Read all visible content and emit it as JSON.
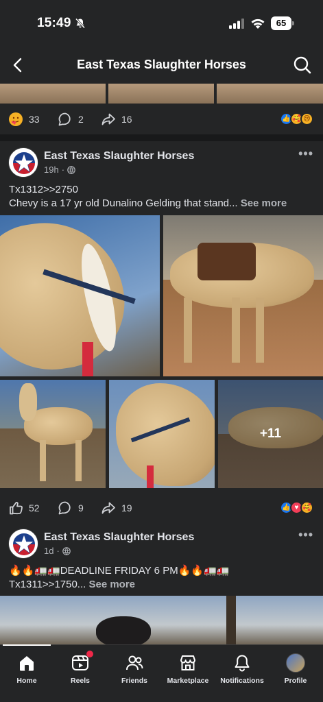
{
  "status_bar": {
    "time": "15:49",
    "battery": "65"
  },
  "header": {
    "title": "East Texas Slaughter Horses"
  },
  "post_prev": {
    "reaction_count": "33",
    "comment_count": "2",
    "share_count": "16"
  },
  "post_main": {
    "author": "East Texas Slaughter Horses",
    "time": "19h",
    "line1": "Tx1312>>2750",
    "line2": "Chevy is a 17 yr old Dunalino Gelding that stand...",
    "see_more": "See more",
    "extra_photos": "+11",
    "reaction_count": "52",
    "comment_count": "9",
    "share_count": "19"
  },
  "post_next": {
    "author": "East Texas Slaughter Horses",
    "time": "1d",
    "line1": "🔥🔥🚛🚛DEADLINE FRIDAY 6 PM🔥🔥🚛🚛",
    "line2": "Tx1311>>1750...",
    "see_more": "See more"
  },
  "nav": {
    "items": [
      {
        "label": "Home",
        "icon": "home-icon",
        "active": true
      },
      {
        "label": "Reels",
        "icon": "reels-icon"
      },
      {
        "label": "Friends",
        "icon": "friends-icon"
      },
      {
        "label": "Marketplace",
        "icon": "marketplace-icon"
      },
      {
        "label": "Notifications",
        "icon": "bell-icon"
      },
      {
        "label": "Profile",
        "icon": "profile-avatar"
      }
    ]
  },
  "colors": {
    "background": "#18191a",
    "surface": "#242526",
    "accent": "#1877f2",
    "badge": "#f02849"
  }
}
